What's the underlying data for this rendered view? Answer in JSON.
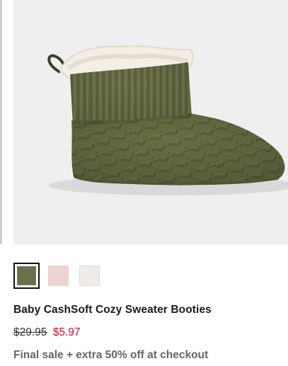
{
  "product": {
    "title": "Baby CashSoft Cozy Sweater Booties",
    "original_price": "$29.95",
    "sale_price": "$5.97",
    "promo_text": "Final sale + extra 50% off at checkout",
    "image_alt": "Olive green cable-knit sweater bootie with sherpa lining"
  },
  "swatches": [
    {
      "color": "olive-green",
      "hex": "#6b7048",
      "selected": true
    },
    {
      "color": "light-pink",
      "hex": "#efd2d2",
      "selected": false
    },
    {
      "color": "ivory",
      "hex": "#f1ebe7",
      "selected": false
    }
  ],
  "colors": {
    "sale": "#c8102e",
    "title": "#1a1a1a",
    "promo": "#666666",
    "image_background": "#efefef"
  }
}
